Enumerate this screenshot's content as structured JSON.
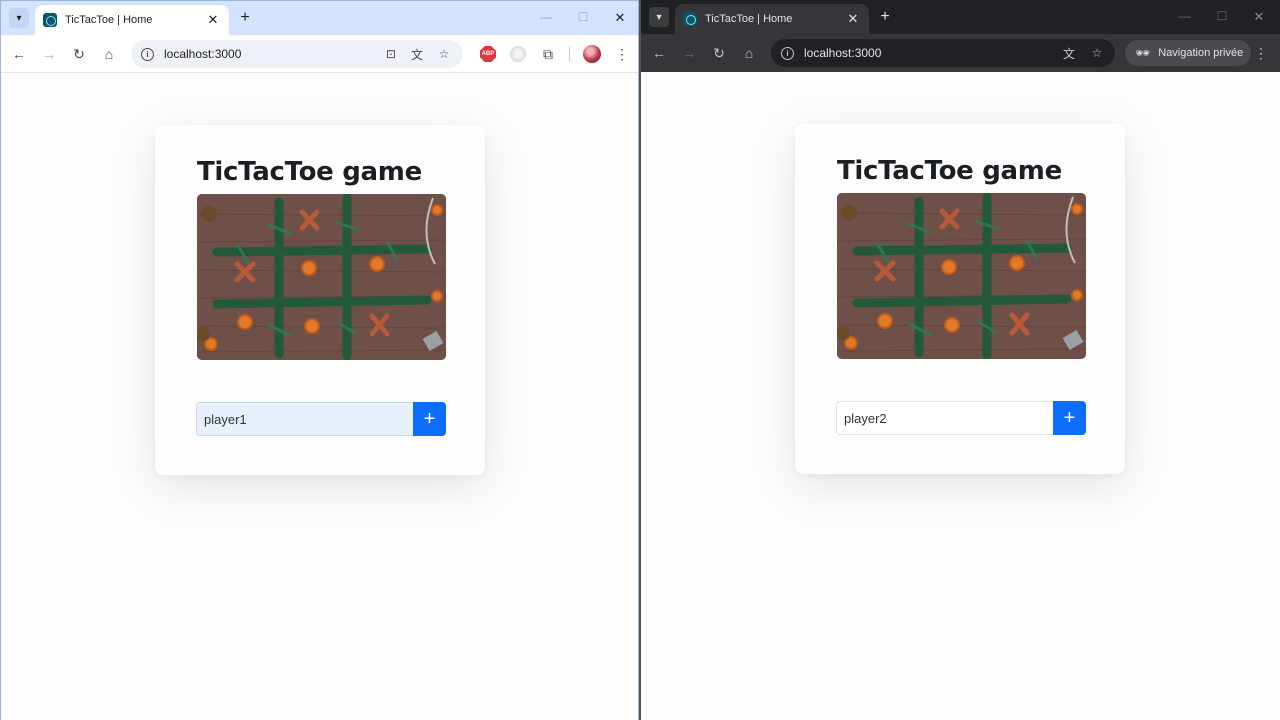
{
  "windows": [
    {
      "id": "left",
      "tab_title": "TicTacToe | Home",
      "url": "localhost:3000",
      "page_title": "TicTacToe game",
      "player_name": "player1"
    },
    {
      "id": "right",
      "tab_title": "TicTacToe | Home",
      "url": "localhost:3000",
      "incognito_label": "Navigation privée",
      "page_title": "TicTacToe game",
      "player_name": "player2"
    }
  ],
  "icons": {
    "tab_list": "▾",
    "close": "✕",
    "new_tab": "+",
    "minimize": "—",
    "maximize": "☐",
    "back": "←",
    "forward": "→",
    "reload": "↻",
    "home": "⌂",
    "install": "⊡",
    "translate": "文",
    "star": "☆",
    "puzzle": "⧉",
    "menu": "⋮",
    "incognito": "🕶",
    "add": "+"
  },
  "colors": {
    "accent": "#0d6efd",
    "light_frame": "#d3e3fd",
    "dark_frame": "#202124"
  }
}
